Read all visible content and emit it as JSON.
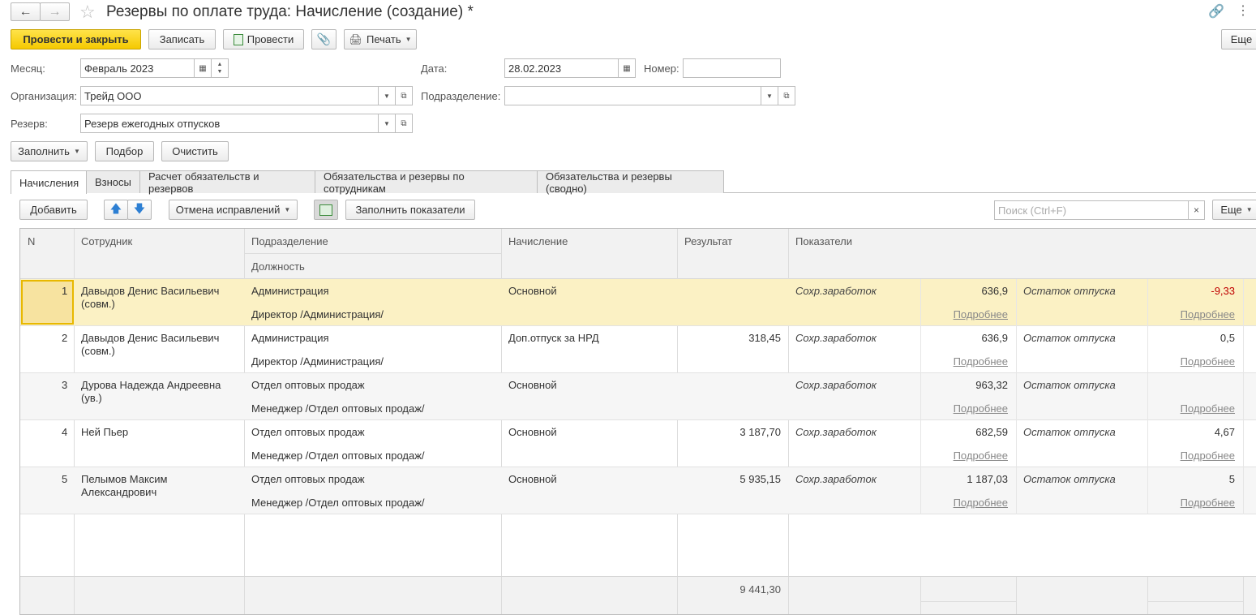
{
  "window": {
    "title": "Резервы по оплате труда: Начисление (создание) *"
  },
  "toolbar": {
    "post_close": "Провести и закрыть",
    "save": "Записать",
    "post": "Провести",
    "print": "Печать",
    "more": "Еще"
  },
  "form": {
    "month_label": "Месяц:",
    "month_value": "Февраль 2023",
    "date_label": "Дата:",
    "date_value": "28.02.2023",
    "number_label": "Номер:",
    "number_value": "",
    "org_label": "Организация:",
    "org_value": "Трейд ООО",
    "dept_label": "Подразделение:",
    "dept_value": "",
    "reserve_label": "Резерв:",
    "reserve_value": "Резерв ежегодных отпусков"
  },
  "actions": {
    "fill": "Заполнить",
    "pick": "Подбор",
    "clear": "Очистить"
  },
  "tabs": [
    {
      "label": "Начисления"
    },
    {
      "label": "Взносы"
    },
    {
      "label": "Расчет обязательств и резервов"
    },
    {
      "label": "Обязательства и резервы по сотрудникам"
    },
    {
      "label": "Обязательства и резервы (сводно)"
    }
  ],
  "table_toolbar": {
    "add": "Добавить",
    "cancel_corrections": "Отмена исправлений",
    "fill_indicators": "Заполнить показатели",
    "search_placeholder": "Поиск (Ctrl+F)",
    "more": "Еще"
  },
  "columns": {
    "n": "N",
    "employee": "Сотрудник",
    "dept": "Подразделение",
    "position": "Должность",
    "accrual": "Начисление",
    "result": "Результат",
    "indicators": "Показатели"
  },
  "rows": [
    {
      "n": "1",
      "employee": "Давыдов Денис Васильевич (совм.)",
      "dept": "Администрация",
      "position": "Директор /Администрация/",
      "accrual": "Основной",
      "result": "",
      "ind1": "Сохр.заработок",
      "val1": "636,9",
      "more1": "Подробнее",
      "ind2": "Остаток отпуска",
      "val2": "-9,33",
      "more2": "Подробнее"
    },
    {
      "n": "2",
      "employee": "Давыдов Денис Васильевич (совм.)",
      "dept": "Администрация",
      "position": "Директор /Администрация/",
      "accrual": "Доп.отпуск за НРД",
      "result": "318,45",
      "ind1": "Сохр.заработок",
      "val1": "636,9",
      "more1": "Подробнее",
      "ind2": "Остаток отпуска",
      "val2": "0,5",
      "more2": "Подробнее"
    },
    {
      "n": "3",
      "employee": "Дурова Надежда Андреевна (ув.)",
      "dept": "Отдел оптовых продаж",
      "position": "Менеджер /Отдел оптовых продаж/",
      "accrual": "Основной",
      "result": "",
      "ind1": "Сохр.заработок",
      "val1": "963,32",
      "more1": "Подробнее",
      "ind2": "Остаток отпуска",
      "val2": "",
      "more2": "Подробнее"
    },
    {
      "n": "4",
      "employee": "Ней Пьер",
      "dept": "Отдел оптовых продаж",
      "position": "Менеджер /Отдел оптовых продаж/",
      "accrual": "Основной",
      "result": "3 187,70",
      "ind1": "Сохр.заработок",
      "val1": "682,59",
      "more1": "Подробнее",
      "ind2": "Остаток отпуска",
      "val2": "4,67",
      "more2": "Подробнее"
    },
    {
      "n": "5",
      "employee": "Пелымов Максим Александрович",
      "dept": "Отдел оптовых продаж",
      "position": "Менеджер /Отдел оптовых продаж/",
      "accrual": "Основной",
      "result": "5 935,15",
      "ind1": "Сохр.заработок",
      "val1": "1 187,03",
      "more1": "Подробнее",
      "ind2": "Остаток отпуска",
      "val2": "5",
      "more2": "Подробнее"
    }
  ],
  "footer": {
    "result_total": "9 441,30"
  }
}
